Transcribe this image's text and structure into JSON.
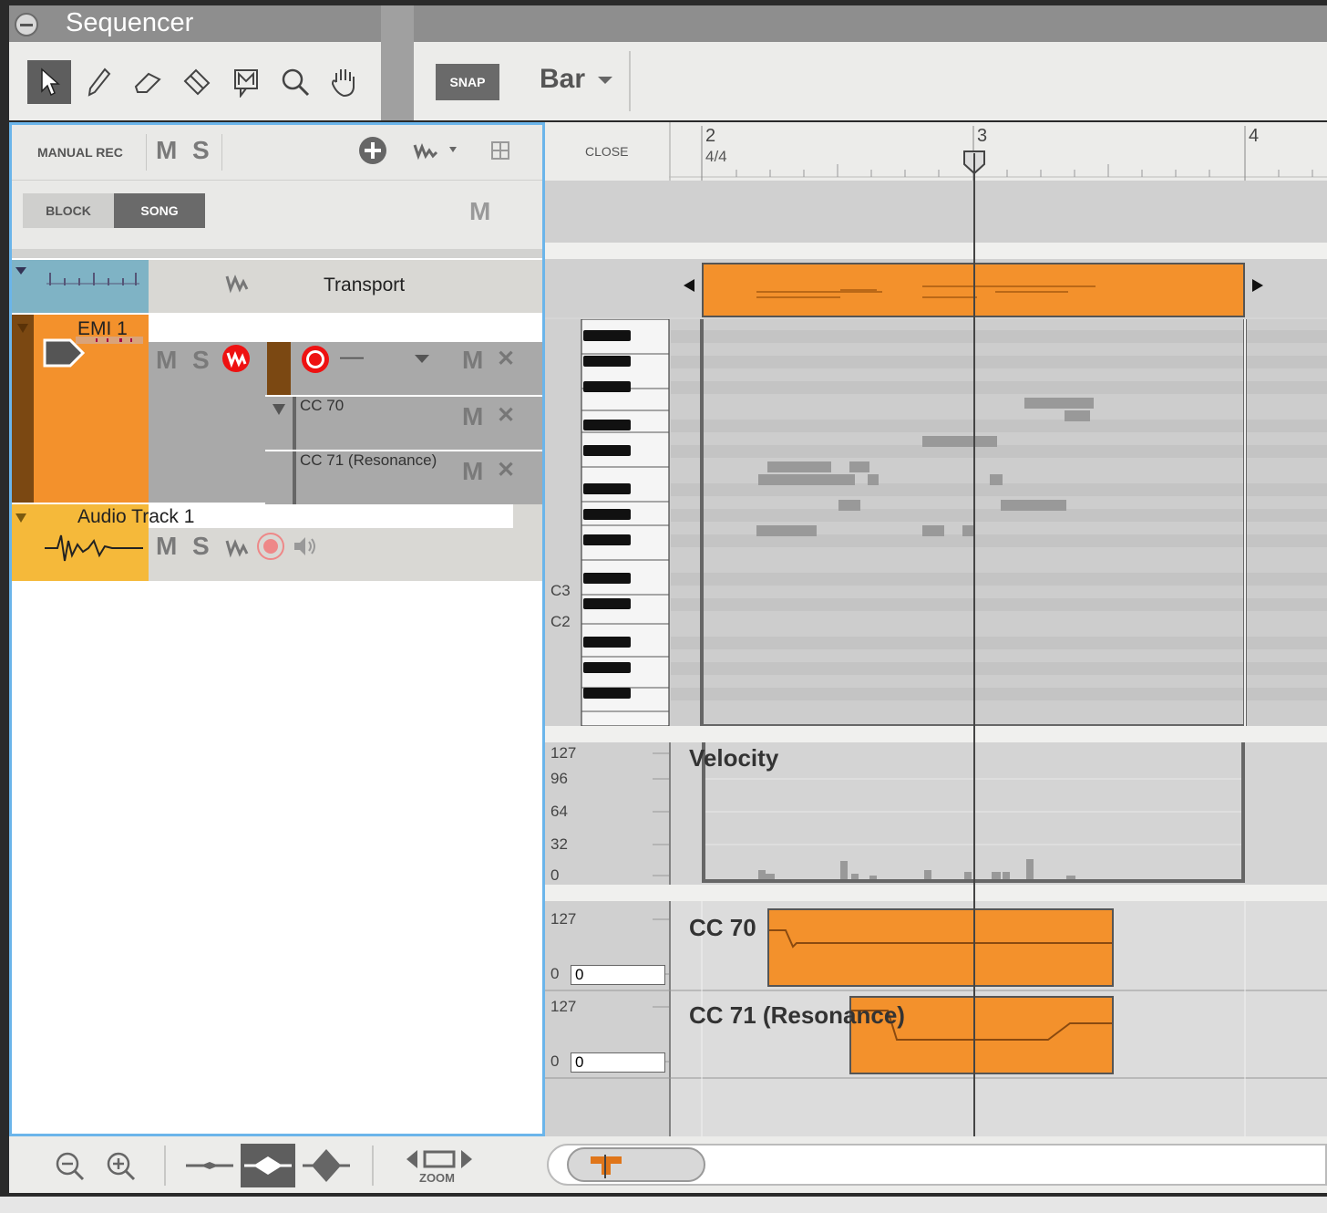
{
  "window": {
    "title": "Sequencer"
  },
  "toolbar": {
    "tools": [
      "pointer-icon",
      "pencil-icon",
      "eraser-icon",
      "razor-icon",
      "mute-tool-icon",
      "magnifier-icon",
      "hand-icon"
    ],
    "snap_label": "SNAP",
    "grid_value": "Bar"
  },
  "left": {
    "manual_rec": "MANUAL REC",
    "m": "M",
    "s": "S",
    "block": "BLOCK",
    "song": "SONG",
    "tracks": {
      "transport": "Transport",
      "emi": "EMI 1",
      "emi_lanes": [
        "CC 70",
        "CC 71 (Resonance)"
      ],
      "audio": "Audio Track 1"
    },
    "dash": "—",
    "x": "✕"
  },
  "right": {
    "close": "CLOSE",
    "bars": [
      "2",
      "3",
      "4"
    ],
    "timesig": "4/4",
    "notes": [
      "C3",
      "C2"
    ],
    "velocity": {
      "title": "Velocity",
      "scale": [
        "127",
        "96",
        "64",
        "32",
        "0"
      ]
    },
    "cc70": {
      "title": "CC 70",
      "top": "127",
      "bottom": "0",
      "value": "0"
    },
    "cc71": {
      "title": "CC 71 (Resonance)",
      "top": "127",
      "bottom": "0",
      "value": "0"
    }
  },
  "bottom": {
    "zoom": "ZOOM"
  },
  "colors": {
    "accent": "#f3912c",
    "selection": "#6bb5ea",
    "audio": "#f5b93a",
    "transport": "#7fb3c5"
  }
}
